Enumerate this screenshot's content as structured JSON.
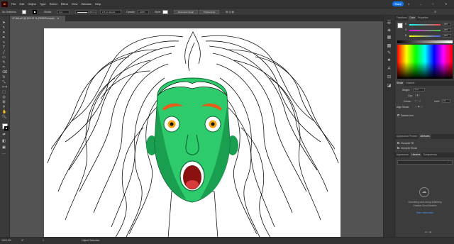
{
  "app": {
    "logo_text": "Ai"
  },
  "menu": [
    "File",
    "Edit",
    "Object",
    "Type",
    "Select",
    "Effect",
    "View",
    "Window",
    "Help"
  ],
  "share_label": "Share",
  "window_controls": {
    "minimize": "–",
    "maximize": "□",
    "close": "✕"
  },
  "control_bar": {
    "selection_label": "No Selection",
    "stroke_label": "Stroke:",
    "stroke_weight": "1 pt",
    "variable_width": "Uniform",
    "brush": "5 pt. Round",
    "opacity_label": "Opacity:",
    "opacity_value": "100%",
    "style_label": "Style:",
    "doc_setup_button": "Document Setup",
    "preferences_button": "Preferences"
  },
  "document_tab": {
    "title": "47.Ai6.ai* @ 109.13 % (RGB/Preview)",
    "close": "✕"
  },
  "right_panels": {
    "top_tabs": [
      "Transform",
      "Color",
      "Properties"
    ],
    "active_top_tab": "Color",
    "color_sliders": [
      {
        "label": "R",
        "value": "255",
        "color": "#ff4040"
      },
      {
        "label": "G",
        "value": "255",
        "color": "#40d040"
      },
      {
        "label": "B",
        "value": "255",
        "color": "#4060ff"
      }
    ],
    "stroke_tabs": [
      "Stroke",
      "Gradient"
    ],
    "stroke": {
      "weight_label": "Weight:",
      "weight_value": "1 pt",
      "cap_label": "Cap:",
      "corner_label": "Corner:",
      "limit_label": "Limit:",
      "limit_value": "10",
      "align_label": "Align Stroke:",
      "dashed_label": "Dashed Line"
    },
    "appearance_tabs": [
      "Appearance Preview",
      "Attributes"
    ],
    "attributes": {
      "overprint_fill": "Overprint Fill",
      "overprint_stroke": "Overprint Stroke"
    },
    "library_tabs": [
      "Appearance",
      "Libraries",
      "Transparency"
    ],
    "libraries": {
      "message_line1": "Something went wrong initializing",
      "message_line2": "Creative Cloud libraries",
      "link": "More information"
    }
  },
  "status_bar": {
    "zoom": "109.13%",
    "rotation": "0°",
    "artboard": "1",
    "tool": "Object Selection"
  },
  "colors": {
    "skin": "#2ecb6c",
    "skin_shadow": "#1a9e4f",
    "skin_dark": "#0e6b36",
    "brow": "#e85d1a",
    "iris": "#f2a30f",
    "mouth": "#8b1111",
    "accent": "#1473e6"
  }
}
